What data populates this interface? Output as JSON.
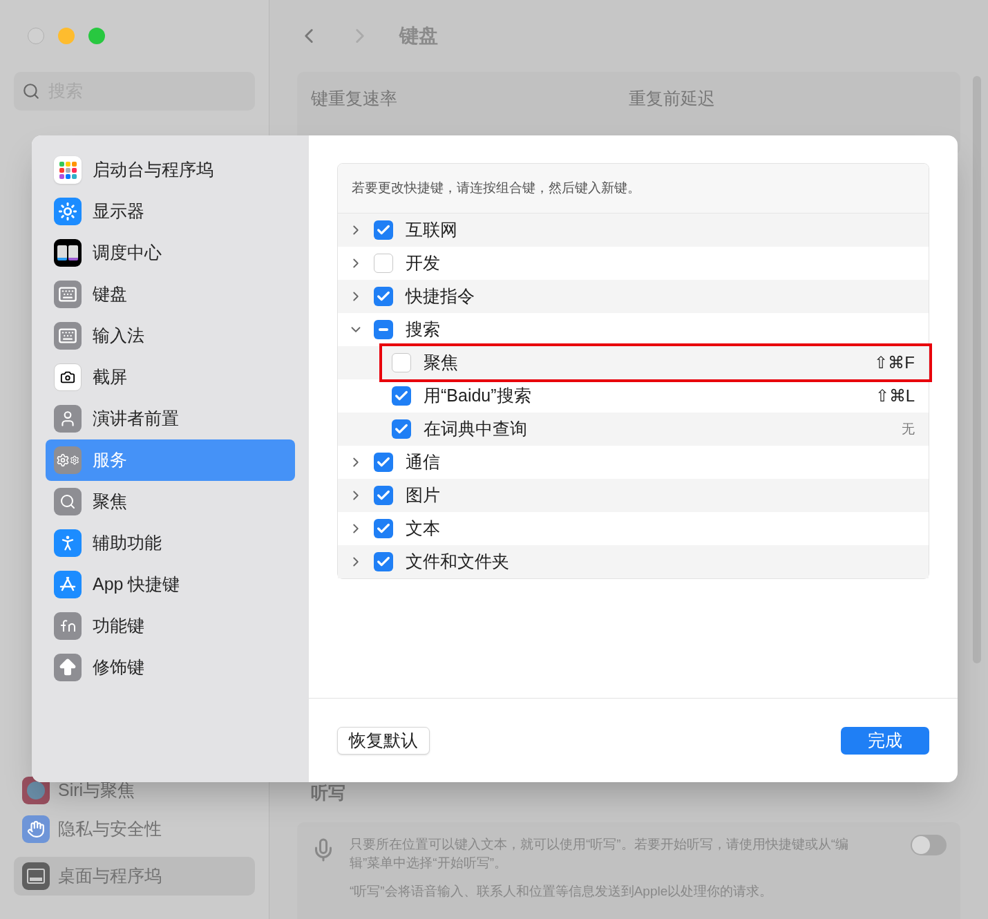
{
  "window": {
    "search": {
      "placeholder": "搜索"
    },
    "title": "键盘"
  },
  "background_sidebar": [
    {
      "label": "Siri与聚焦",
      "selected": false
    },
    {
      "label": "隐私与安全性",
      "selected": false
    },
    {
      "label": "桌面与程序坞",
      "selected": true
    }
  ],
  "keyboard_card": {
    "labels": [
      "键重复速率",
      "重复前延迟"
    ]
  },
  "dictation": {
    "heading": "听写",
    "text": "只要所在位置可以键入文本，就可以使用“听写”。若要开始听写，请使用快捷键或从“编辑”菜单中选择“开始听写”。",
    "note": "“听写”会将语音输入、联系人和位置等信息发送到Apple以处理你的请求。",
    "on": false
  },
  "dialog": {
    "sidebar": [
      {
        "label": "启动台与程序坞",
        "selected": false
      },
      {
        "label": "显示器",
        "selected": false
      },
      {
        "label": "调度中心",
        "selected": false
      },
      {
        "label": "键盘",
        "selected": false
      },
      {
        "label": "输入法",
        "selected": false
      },
      {
        "label": "截屏",
        "selected": false
      },
      {
        "label": "演讲者前置",
        "selected": false
      },
      {
        "label": "服务",
        "selected": true
      },
      {
        "label": "聚焦",
        "selected": false
      },
      {
        "label": "辅助功能",
        "selected": false
      },
      {
        "label": "App 快捷键",
        "selected": false
      },
      {
        "label": "功能键",
        "selected": false
      },
      {
        "label": "修饰键",
        "selected": false
      }
    ],
    "hint": "若要更改快捷键，请连按组合键，然后键入新键。",
    "services": [
      {
        "label": "互联网",
        "checked": true,
        "expanded": false
      },
      {
        "label": "开发",
        "checked": false,
        "expanded": false
      },
      {
        "label": "快捷指令",
        "checked": true,
        "expanded": false
      },
      {
        "label": "搜索",
        "mixed": true,
        "expanded": true,
        "children": [
          {
            "label": "聚焦",
            "checked": false,
            "shortcut": "⇧⌘F",
            "highlighted": true
          },
          {
            "label": "用“Baidu”搜索",
            "checked": true,
            "shortcut": "⇧⌘L",
            "highlighted": false
          },
          {
            "label": "在词典中查询",
            "checked": true,
            "shortcut": "无",
            "highlighted": false
          }
        ]
      },
      {
        "label": "通信",
        "checked": true,
        "expanded": false
      },
      {
        "label": "图片",
        "checked": true,
        "expanded": false
      },
      {
        "label": "文本",
        "checked": true,
        "expanded": false
      },
      {
        "label": "文件和文件夹",
        "checked": true,
        "expanded": false
      }
    ],
    "buttons": {
      "restore": "恢复默认",
      "done": "完成"
    }
  }
}
